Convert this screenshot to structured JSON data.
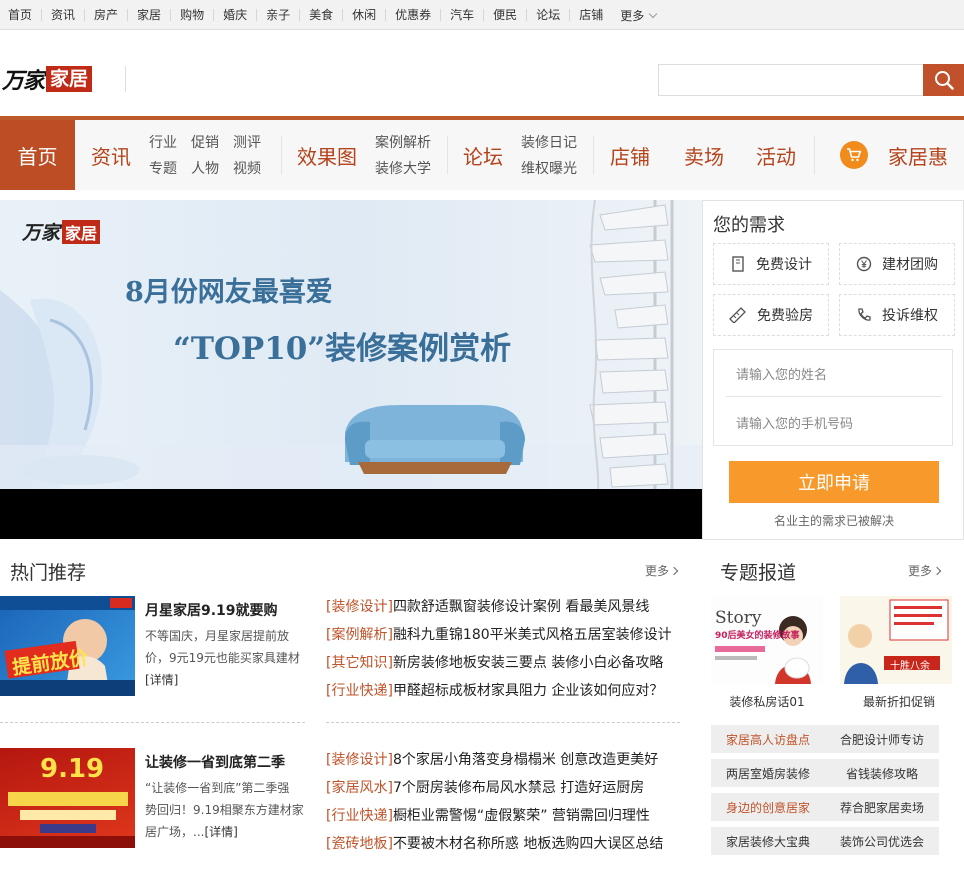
{
  "topbar": {
    "links": [
      "首页",
      "资讯",
      "房产",
      "家居",
      "购物",
      "婚庆",
      "亲子",
      "美食",
      "休闲",
      "优惠券",
      "汽车",
      "便民",
      "论坛",
      "店铺"
    ],
    "more": "更多"
  },
  "logo": {
    "part1": "万家",
    "part2": "家居"
  },
  "search": {
    "placeholder": ""
  },
  "nav": {
    "home": "首页",
    "news": "资讯",
    "sub1": {
      "a": "行业",
      "b": "专题",
      "c": "促销",
      "d": "人物",
      "e": "测评",
      "f": "视频"
    },
    "gallery": "效果图",
    "sub2": {
      "a": "案例解析",
      "b": "装修大学"
    },
    "forum": "论坛",
    "sub3": {
      "a": "装修日记",
      "b": "维权曝光"
    },
    "shops": "店铺",
    "market": "卖场",
    "events": "活动",
    "deals": "家居惠"
  },
  "banner": {
    "logo1": "万家",
    "logo2": "家居",
    "line1": "8月份网友最喜爱",
    "line2": "“TOP10”装修案例赏析"
  },
  "need": {
    "title": "您的需求",
    "b1": "免费设计",
    "b2": "建材团购",
    "b3": "免费验房",
    "b4": "投诉维权",
    "name_ph": "请输入您的姓名",
    "phone_ph": "请输入您的手机号码",
    "apply": "立即申请",
    "solved": "名业主的需求已被解决"
  },
  "hot": {
    "title": "热门推荐",
    "more": "更多",
    "items": [
      {
        "title": "月星家居9.19就要购",
        "desc1": "不等国庆，月星家居提前放",
        "desc2": "价，9元19元也能买家具建材",
        "link": "[详情]",
        "img_text": "提前放价"
      },
      {
        "title": "让装修一省到底第二季",
        "desc1": "“让装修一省到底”第二季强",
        "desc2": "势回归！9.19相聚东方建材家",
        "desc3": "居广场，...",
        "link": "[详情]",
        "img_text": "9.19"
      }
    ],
    "news1": [
      {
        "tag": "[装修设计]",
        "text": "四款舒适飘窗装修设计案例 看最美风景线"
      },
      {
        "tag": "[案例解析]",
        "text": "融科九重锦180平米美式风格五居室装修设计"
      },
      {
        "tag": "[其它知识]",
        "text": "新房装修地板安装三要点 装修小白必备攻略"
      },
      {
        "tag": "[行业快递]",
        "text": "甲醛超标成板材家具阻力 企业该如何应对？"
      }
    ],
    "news2": [
      {
        "tag": "[装修设计]",
        "text": "8个家居小角落变身榻榻米 创意改造更美好"
      },
      {
        "tag": "[家居风水]",
        "text": "7个厨房装修布局风水禁忌 打造好运厨房"
      },
      {
        "tag": "[行业快递]",
        "text": "橱柜业需警惕“虚假繁荣” 营销需回归理性"
      },
      {
        "tag": "[瓷砖地板]",
        "text": "不要被木材名称所惑 地板选购四大误区总结"
      }
    ]
  },
  "special": {
    "title": "专题报道",
    "more": "更多",
    "cap1": "装修私房话01",
    "cap2": "最新折扣促销",
    "story": "Story",
    "story_sub": "90后美女的装修故事",
    "sign": "十胜八余",
    "buttons": [
      "家居高人访盘点",
      "合肥设计师专访",
      "两居室婚房装修",
      "省钱装修攻略",
      "身边的创意居家",
      "荐合肥家居卖场",
      "家居装修大宝典",
      "装饰公司优选会"
    ]
  },
  "colors": {
    "brand": "#bd4d24",
    "accent": "#f79a2b",
    "tag": "#c0532a"
  }
}
